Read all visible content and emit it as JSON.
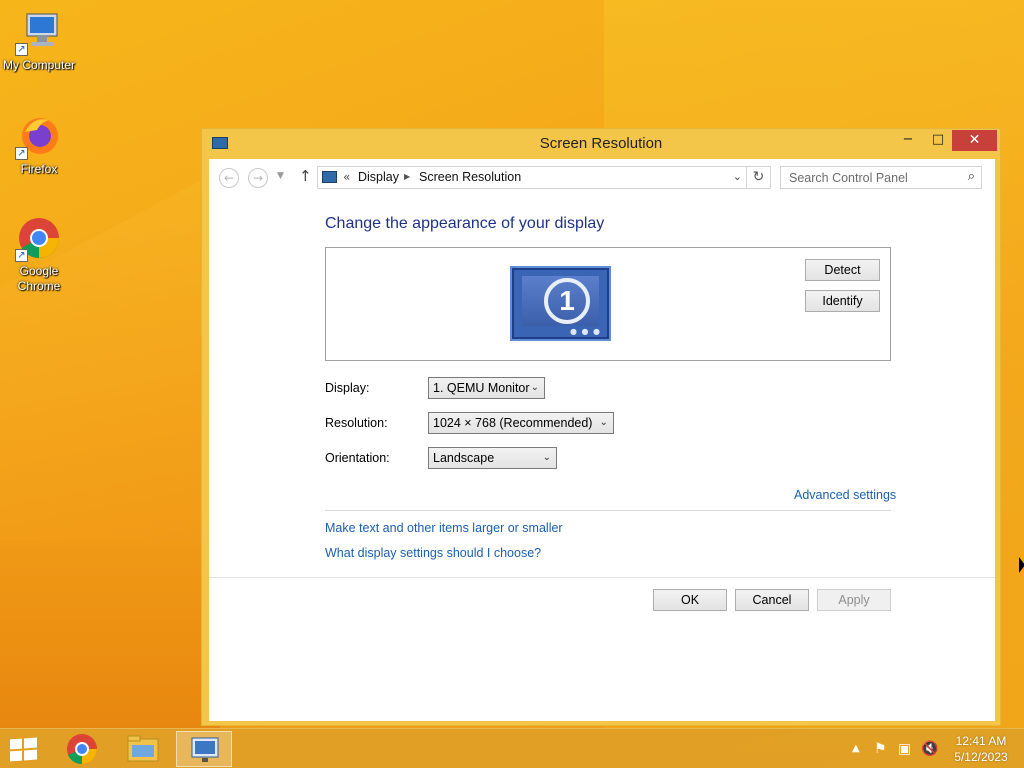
{
  "desktop": {
    "icons": [
      {
        "label": "My Computer"
      },
      {
        "label": "Firefox"
      },
      {
        "label": "Google Chrome"
      }
    ]
  },
  "window": {
    "title": "Screen Resolution",
    "controls": {
      "minimize": "−",
      "maximize": "□",
      "close": "✕"
    },
    "address_bar": {
      "prefix": "«",
      "breadcrumbs": [
        "Display",
        "Screen Resolution"
      ]
    },
    "search": {
      "placeholder": "Search Control Panel"
    },
    "heading": "Change the appearance of your display",
    "monitor": {
      "number": "1"
    },
    "buttons": {
      "detect": "Detect",
      "identify": "Identify"
    },
    "fields": {
      "display_label": "Display:",
      "display_value": "1. QEMU Monitor",
      "resolution_label": "Resolution:",
      "resolution_value": "1024 × 768 (Recommended)",
      "orientation_label": "Orientation:",
      "orientation_value": "Landscape"
    },
    "links": {
      "advanced": "Advanced settings",
      "text_size": "Make text and other items larger or smaller",
      "which_settings": "What display settings should I choose?"
    },
    "dialog_buttons": {
      "ok": "OK",
      "cancel": "Cancel",
      "apply": "Apply"
    }
  },
  "taskbar": {
    "clock": {
      "time": "12:41 AM",
      "date": "5/12/2023"
    },
    "items": [
      "start-button",
      "chrome",
      "file-explorer",
      "screen-resolution"
    ]
  },
  "colors": {
    "accent": "#1e3287",
    "link": "#1b5fb0",
    "window_frame": "#f3c64a",
    "close_button": "#c7413a"
  }
}
